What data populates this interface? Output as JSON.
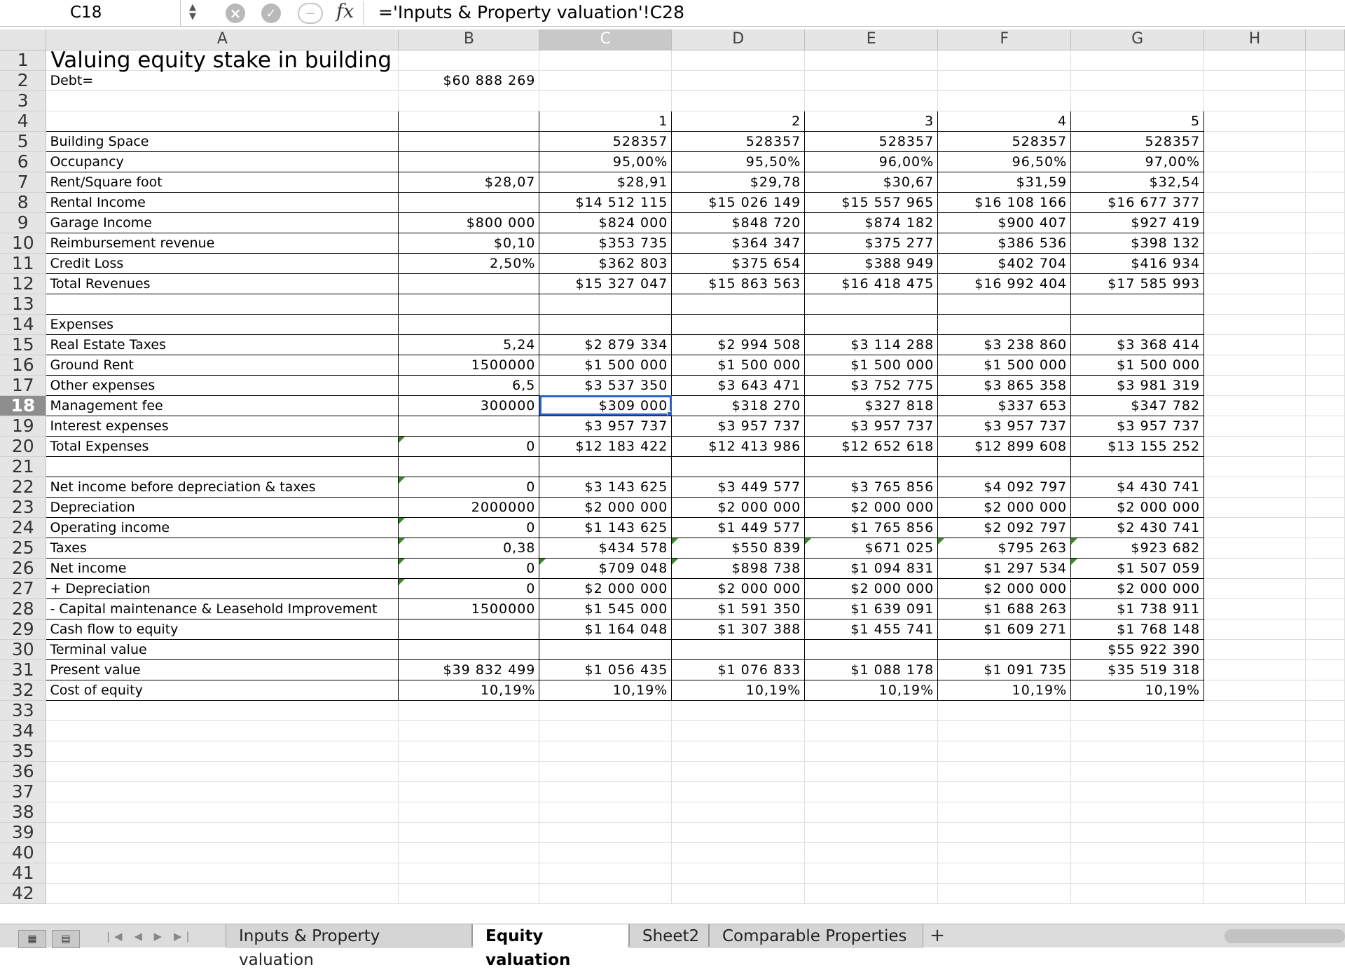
{
  "formula_bar": {
    "cell_ref": "C18",
    "formula": "='Inputs & Property valuation'!C28",
    "fx_label": "fx"
  },
  "columns": [
    "A",
    "B",
    "C",
    "D",
    "E",
    "F",
    "G",
    "H"
  ],
  "selected_cell": "C18",
  "rows": [
    {
      "n": "1",
      "a": "Valuing equity stake in building",
      "b": "",
      "c": "",
      "d": "",
      "e": "",
      "f": "",
      "g": ""
    },
    {
      "n": "2",
      "a": "Debt=",
      "b": "$60 888 269",
      "c": "",
      "d": "",
      "e": "",
      "f": "",
      "g": ""
    },
    {
      "n": "3",
      "a": "",
      "b": "",
      "c": "",
      "d": "",
      "e": "",
      "f": "",
      "g": ""
    },
    {
      "n": "4",
      "a": "",
      "b": "",
      "c": "1",
      "d": "2",
      "e": "3",
      "f": "4",
      "g": "5"
    },
    {
      "n": "5",
      "a": "Building Space",
      "b": "",
      "c": "528357",
      "d": "528357",
      "e": "528357",
      "f": "528357",
      "g": "528357"
    },
    {
      "n": "6",
      "a": "Occupancy",
      "b": "",
      "c": "95,00%",
      "d": "95,50%",
      "e": "96,00%",
      "f": "96,50%",
      "g": "97,00%"
    },
    {
      "n": "7",
      "a": "Rent/Square foot",
      "b": "$28,07",
      "c": "$28,91",
      "d": "$29,78",
      "e": "$30,67",
      "f": "$31,59",
      "g": "$32,54"
    },
    {
      "n": "8",
      "a": "Rental Income",
      "b": "",
      "c": "$14 512 115",
      "d": "$15 026 149",
      "e": "$15 557 965",
      "f": "$16 108 166",
      "g": "$16 677 377"
    },
    {
      "n": "9",
      "a": "Garage Income",
      "b": "$800 000",
      "c": "$824 000",
      "d": "$848 720",
      "e": "$874 182",
      "f": "$900 407",
      "g": "$927 419"
    },
    {
      "n": "10",
      "a": "Reimbursement revenue",
      "b": "$0,10",
      "c": "$353 735",
      "d": "$364 347",
      "e": "$375 277",
      "f": "$386 536",
      "g": "$398 132"
    },
    {
      "n": "11",
      "a": "Credit Loss",
      "b": "2,50%",
      "c": "$362 803",
      "d": "$375 654",
      "e": "$388 949",
      "f": "$402 704",
      "g": "$416 934"
    },
    {
      "n": "12",
      "a": "Total Revenues",
      "b": "",
      "c": "$15 327 047",
      "d": "$15 863 563",
      "e": "$16 418 475",
      "f": "$16 992 404",
      "g": "$17 585 993"
    },
    {
      "n": "13",
      "a": "",
      "b": "",
      "c": "",
      "d": "",
      "e": "",
      "f": "",
      "g": ""
    },
    {
      "n": "14",
      "a": "Expenses",
      "b": "",
      "c": "",
      "d": "",
      "e": "",
      "f": "",
      "g": ""
    },
    {
      "n": "15",
      "a": "Real Estate Taxes",
      "b": "5,24",
      "c": "$2 879 334",
      "d": "$2 994 508",
      "e": "$3 114 288",
      "f": "$3 238 860",
      "g": "$3 368 414"
    },
    {
      "n": "16",
      "a": "Ground Rent",
      "b": "1500000",
      "c": "$1 500 000",
      "d": "$1 500 000",
      "e": "$1 500 000",
      "f": "$1 500 000",
      "g": "$1 500 000"
    },
    {
      "n": "17",
      "a": "Other expenses",
      "b": "6,5",
      "c": "$3 537 350",
      "d": "$3 643 471",
      "e": "$3 752 775",
      "f": "$3 865 358",
      "g": "$3 981 319"
    },
    {
      "n": "18",
      "a": "Management fee",
      "b": "300000",
      "c": "$309 000",
      "d": "$318 270",
      "e": "$327 818",
      "f": "$337 653",
      "g": "$347 782"
    },
    {
      "n": "19",
      "a": "Interest expenses",
      "b": "",
      "c": "$3 957 737",
      "d": "$3 957 737",
      "e": "$3 957 737",
      "f": "$3 957 737",
      "g": "$3 957 737"
    },
    {
      "n": "20",
      "a": "Total Expenses",
      "b": "0",
      "c": "$12 183 422",
      "d": "$12 413 986",
      "e": "$12 652 618",
      "f": "$12 899 608",
      "g": "$13 155 252"
    },
    {
      "n": "21",
      "a": "",
      "b": "",
      "c": "",
      "d": "",
      "e": "",
      "f": "",
      "g": ""
    },
    {
      "n": "22",
      "a": "Net income before depreciation & taxes",
      "b": "0",
      "c": "$3 143 625",
      "d": "$3 449 577",
      "e": "$3 765 856",
      "f": "$4 092 797",
      "g": "$4 430 741"
    },
    {
      "n": "23",
      "a": "Depreciation",
      "b": "2000000",
      "c": "$2 000 000",
      "d": "$2 000 000",
      "e": "$2 000 000",
      "f": "$2 000 000",
      "g": "$2 000 000"
    },
    {
      "n": "24",
      "a": "Operating income",
      "b": "0",
      "c": "$1 143 625",
      "d": "$1 449 577",
      "e": "$1 765 856",
      "f": "$2 092 797",
      "g": "$2 430 741"
    },
    {
      "n": "25",
      "a": "Taxes",
      "b": "0,38",
      "c": "$434 578",
      "d": "$550 839",
      "e": "$671 025",
      "f": "$795 263",
      "g": "$923 682"
    },
    {
      "n": "26",
      "a": "Net income",
      "b": "0",
      "c": "$709 048",
      "d": "$898 738",
      "e": "$1 094 831",
      "f": "$1 297 534",
      "g": "$1 507 059"
    },
    {
      "n": "27",
      "a": " + Depreciation",
      "b": "0",
      "c": "$2 000 000",
      "d": "$2 000 000",
      "e": "$2 000 000",
      "f": "$2 000 000",
      "g": "$2 000 000"
    },
    {
      "n": "28",
      "a": " - Capital maintenance & Leasehold Improvement",
      "b": "1500000",
      "c": "$1 545 000",
      "d": "$1 591 350",
      "e": "$1 639 091",
      "f": "$1 688 263",
      "g": "$1 738 911"
    },
    {
      "n": "29",
      "a": "Cash flow to equity",
      "b": "",
      "c": "$1 164 048",
      "d": "$1 307 388",
      "e": "$1 455 741",
      "f": "$1 609 271",
      "g": "$1 768 148"
    },
    {
      "n": "30",
      "a": "Terminal value",
      "b": "",
      "c": "",
      "d": "",
      "e": "",
      "f": "",
      "g": "$55 922 390"
    },
    {
      "n": "31",
      "a": "Present value",
      "b": "$39 832 499",
      "c": "$1 056 435",
      "d": "$1 076 833",
      "e": "$1 088 178",
      "f": "$1 091 735",
      "g": "$35 519 318"
    },
    {
      "n": "32",
      "a": "Cost of equity",
      "b": "10,19%",
      "c": "10,19%",
      "d": "10,19%",
      "e": "10,19%",
      "f": "10,19%",
      "g": "10,19%"
    },
    {
      "n": "33",
      "a": "",
      "b": "",
      "c": "",
      "d": "",
      "e": "",
      "f": "",
      "g": ""
    },
    {
      "n": "34",
      "a": "",
      "b": "",
      "c": "",
      "d": "",
      "e": "",
      "f": "",
      "g": ""
    },
    {
      "n": "35",
      "a": "",
      "b": "",
      "c": "",
      "d": "",
      "e": "",
      "f": "",
      "g": ""
    },
    {
      "n": "36",
      "a": "",
      "b": "",
      "c": "",
      "d": "",
      "e": "",
      "f": "",
      "g": ""
    },
    {
      "n": "37",
      "a": "",
      "b": "",
      "c": "",
      "d": "",
      "e": "",
      "f": "",
      "g": ""
    },
    {
      "n": "38",
      "a": "",
      "b": "",
      "c": "",
      "d": "",
      "e": "",
      "f": "",
      "g": ""
    },
    {
      "n": "39",
      "a": "",
      "b": "",
      "c": "",
      "d": "",
      "e": "",
      "f": "",
      "g": ""
    },
    {
      "n": "40",
      "a": "",
      "b": "",
      "c": "",
      "d": "",
      "e": "",
      "f": "",
      "g": ""
    },
    {
      "n": "41",
      "a": "",
      "b": "",
      "c": "",
      "d": "",
      "e": "",
      "f": "",
      "g": ""
    },
    {
      "n": "42",
      "a": "",
      "b": "",
      "c": "",
      "d": "",
      "e": "",
      "f": "",
      "g": ""
    }
  ],
  "sheet_tabs": [
    {
      "label": "Inputs & Property valuation",
      "active": false
    },
    {
      "label": "Equity valuation",
      "active": true
    },
    {
      "label": "Sheet2",
      "active": false
    },
    {
      "label": "Comparable Properties",
      "active": false
    }
  ],
  "add_tab_label": "+"
}
